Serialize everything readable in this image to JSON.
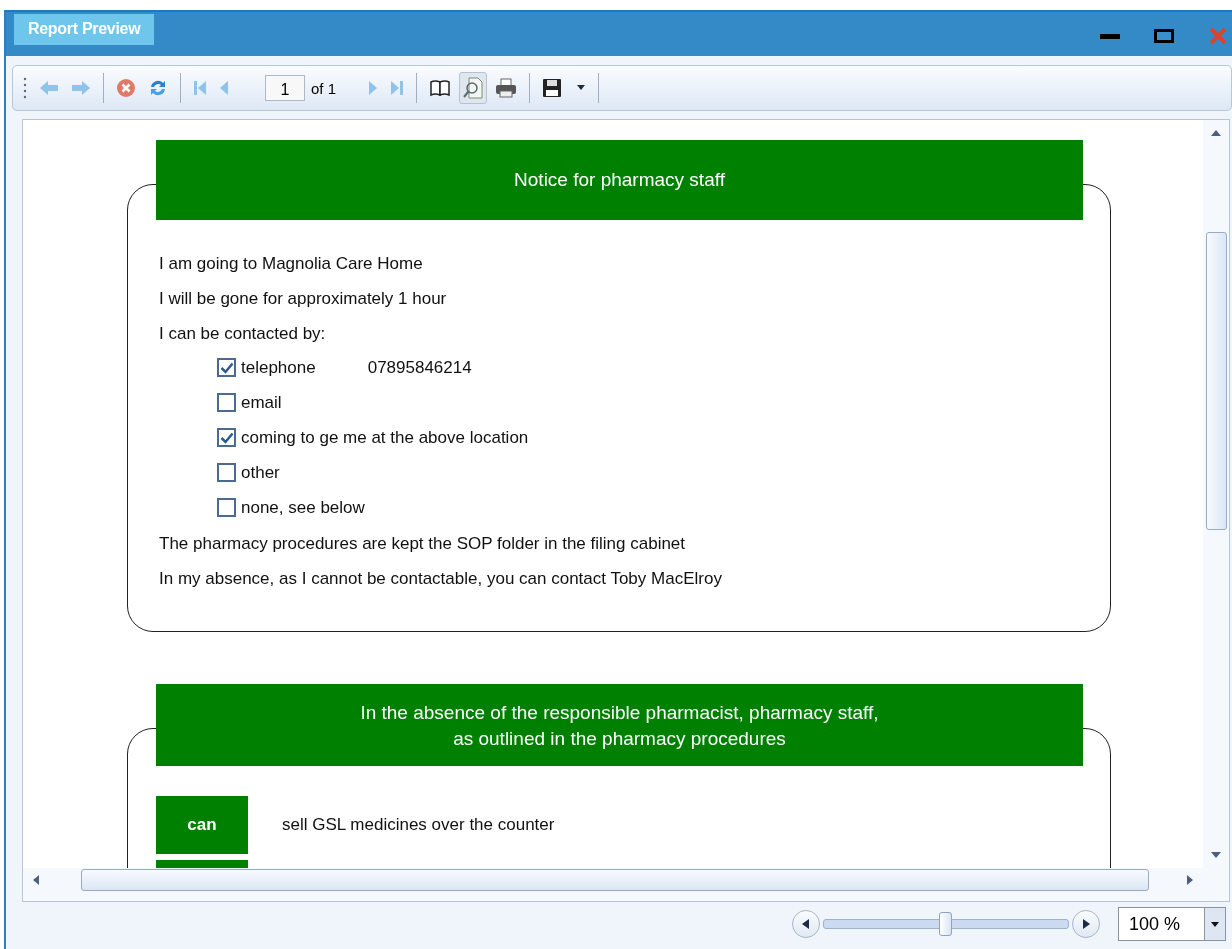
{
  "window": {
    "title": "Report Preview"
  },
  "toolbar": {
    "buttons": [
      {
        "kind": "back",
        "pressed": false
      },
      {
        "kind": "forward",
        "pressed": false
      },
      {
        "kind": "stop",
        "pressed": false
      },
      {
        "kind": "refresh",
        "pressed": false
      },
      {
        "kind": "first",
        "pressed": false
      },
      {
        "kind": "previous",
        "pressed": false
      },
      {
        "kind": "page"
      },
      {
        "kind": "next",
        "pressed": false
      },
      {
        "kind": "last",
        "pressed": false
      },
      {
        "kind": "book",
        "pressed": false
      },
      {
        "kind": "find",
        "pressed": true
      },
      {
        "kind": "print",
        "pressed": false
      },
      {
        "kind": "save",
        "pressed": false
      }
    ],
    "page_number": "1",
    "page_count": "of 1"
  },
  "notice": {
    "title": "Notice for pharmacy staff",
    "lines_before": [
      "I am going to Magnolia Care Home",
      "I will be gone for approximately 1 hour",
      "I can be contacted by:"
    ],
    "contact_options": [
      {
        "label": "telephone",
        "checked": true,
        "value": "07895846214"
      },
      {
        "label": "email",
        "checked": false
      },
      {
        "label": "coming to ge me at the above location",
        "checked": true
      },
      {
        "label": "other",
        "checked": false
      },
      {
        "label": "none, see below",
        "checked": false
      }
    ],
    "lines_after": [
      "The pharmacy procedures are kept the SOP folder in the filing cabinet",
      "In my absence, as I cannot be contactable, you can contact Toby MacElroy"
    ]
  },
  "absence": {
    "title_lines": [
      "In the absence of the responsible pharmacist, pharmacy staff,",
      "as outlined in the pharmacy procedures"
    ],
    "rows": [
      {
        "kind": "full",
        "badge": "can",
        "text": "sell GSL medicines over the counter"
      },
      {
        "kind": "partial"
      }
    ]
  },
  "zoom": {
    "level": 0.5,
    "value": "100 %"
  }
}
